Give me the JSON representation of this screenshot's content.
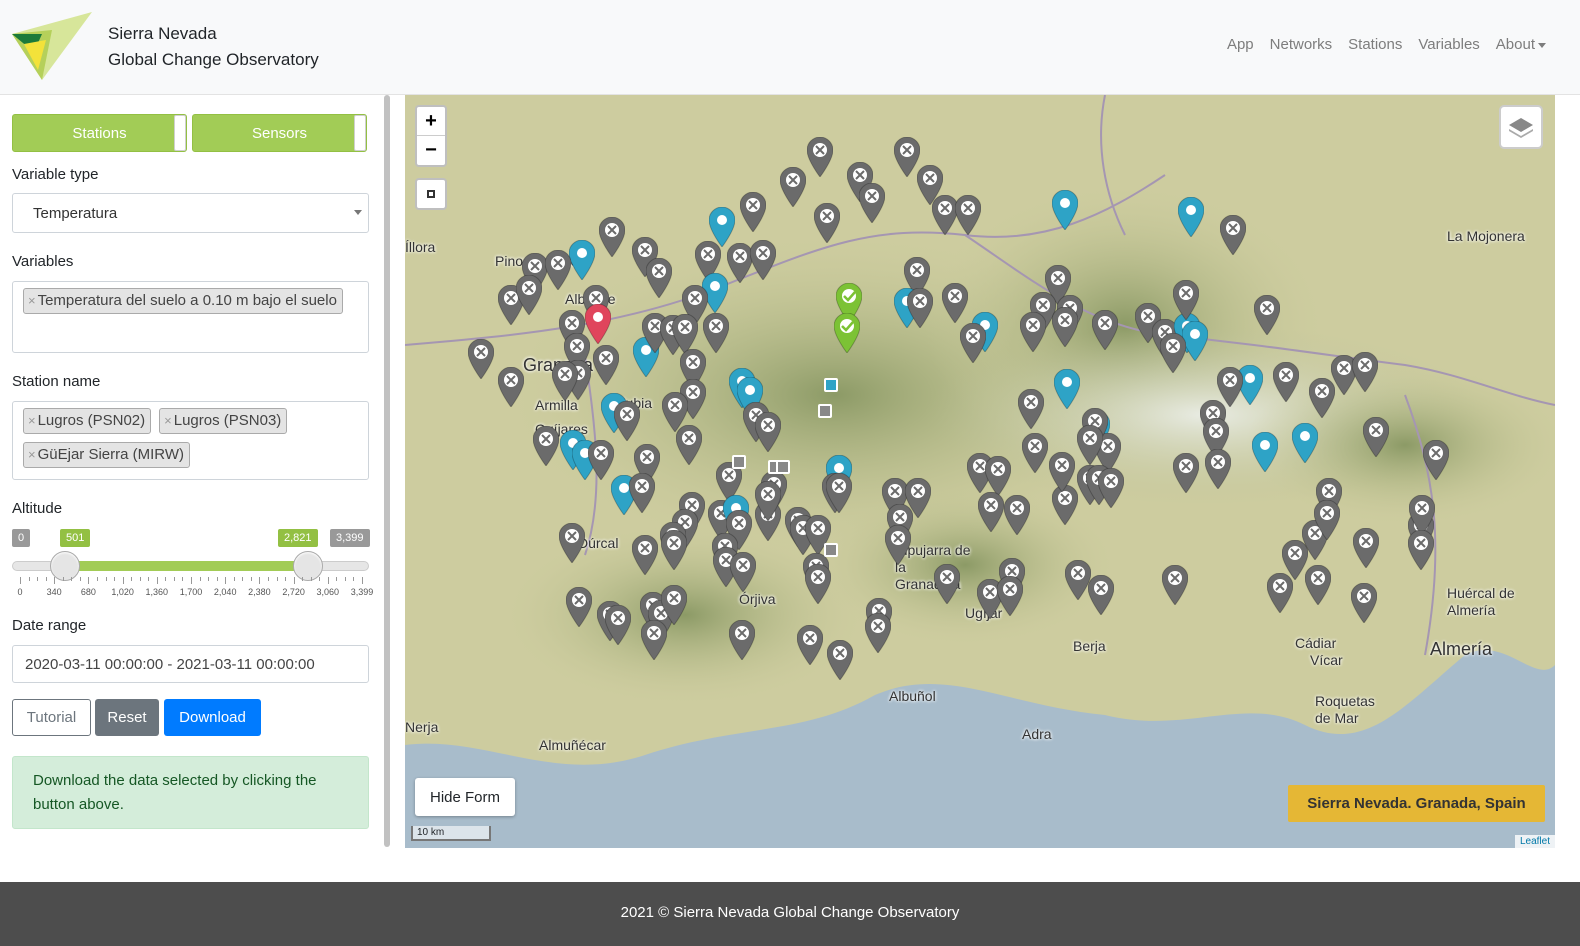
{
  "header": {
    "brand_line1": "Sierra Nevada",
    "brand_line2": "Global Change Observatory",
    "nav": [
      "App",
      "Networks",
      "Stations",
      "Variables",
      "About"
    ]
  },
  "form": {
    "toggle_stations": "Stations",
    "toggle_sensors": "Sensors",
    "variable_type_label": "Variable type",
    "variable_type_value": "Temperatura",
    "variables_label": "Variables",
    "variables_selected": [
      "Temperatura del suelo a 0.10 m bajo el suelo"
    ],
    "station_name_label": "Station name",
    "stations_selected": [
      "Lugros (PSN02)",
      "Lugros (PSN03)",
      "GüEjar Sierra (MIRW)"
    ],
    "altitude_label": "Altitude",
    "altitude_min": "0",
    "altitude_from": "501",
    "altitude_to": "2,821",
    "altitude_max": "3,399",
    "altitude_range": {
      "min": 0,
      "max": 3399,
      "from": 501,
      "to": 2821
    },
    "altitude_ticks": [
      "0",
      "340",
      "680",
      "1,020",
      "1,360",
      "1,700",
      "2,040",
      "2,380",
      "2,720",
      "3,060",
      "3,399"
    ],
    "date_range_label": "Date range",
    "date_range_value": "2020-03-11 00:00:00 - 2021-03-11 00:00:00",
    "btn_tutorial": "Tutorial",
    "btn_reset": "Reset",
    "btn_download": "Download",
    "alert_text": "Download the data selected by clicking the button above."
  },
  "map": {
    "zoom_in": "+",
    "zoom_out": "−",
    "hide_form": "Hide Form",
    "region_label": "Sierra Nevada. Granada, Spain",
    "scale": "10 km",
    "attribution": "Leaflet",
    "places": [
      "Pinos Puente",
      "Albolote",
      "Granada",
      "Armilla",
      "Ogíjares",
      "Zubia",
      "Dúrcal",
      "Órjiva",
      "Cádiar",
      "Ugíjar",
      "Alpujarra de la Granadina",
      "Berja",
      "Albuñol",
      "Adra",
      "Vícar",
      "Roquetas de Mar",
      "Almería",
      "Huércal de Almería",
      "La Mojonera",
      "Almuñécar",
      "Íllora",
      "Nerja"
    ],
    "colors": {
      "active": "#2ea3c6",
      "inactive": "#6b6b6b",
      "selected_ok": "#7cc235",
      "highlight": "#e0455c"
    }
  },
  "footer": {
    "text": "2021 © Sierra Nevada Global Change Observatory"
  }
}
